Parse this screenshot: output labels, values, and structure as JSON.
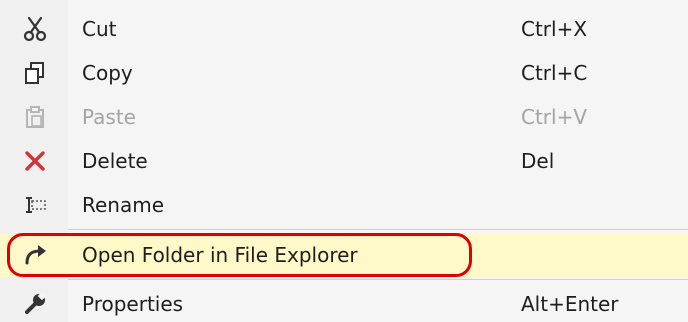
{
  "menu": {
    "items": [
      {
        "label": "Cut",
        "shortcut": "Ctrl+X",
        "icon": "scissors-icon",
        "enabled": true
      },
      {
        "label": "Copy",
        "shortcut": "Ctrl+C",
        "icon": "copy-icon",
        "enabled": true
      },
      {
        "label": "Paste",
        "shortcut": "Ctrl+V",
        "icon": "paste-icon",
        "enabled": false
      },
      {
        "label": "Delete",
        "shortcut": "Del",
        "icon": "delete-x-icon",
        "enabled": true
      },
      {
        "label": "Rename",
        "shortcut": "",
        "icon": "rename-icon",
        "enabled": true
      },
      {
        "label": "Open Folder in File Explorer",
        "shortcut": "",
        "icon": "open-folder-arrow-icon",
        "enabled": true,
        "highlighted": true
      },
      {
        "label": "Properties",
        "shortcut": "Alt+Enter",
        "icon": "wrench-icon",
        "enabled": true
      }
    ]
  },
  "colors": {
    "menu_background": "#f5f5f5",
    "highlight_background": "#fff8c8",
    "disabled_text": "#a2a4a5",
    "delete_icon": "#d13438",
    "callout_outline": "#e00000"
  }
}
